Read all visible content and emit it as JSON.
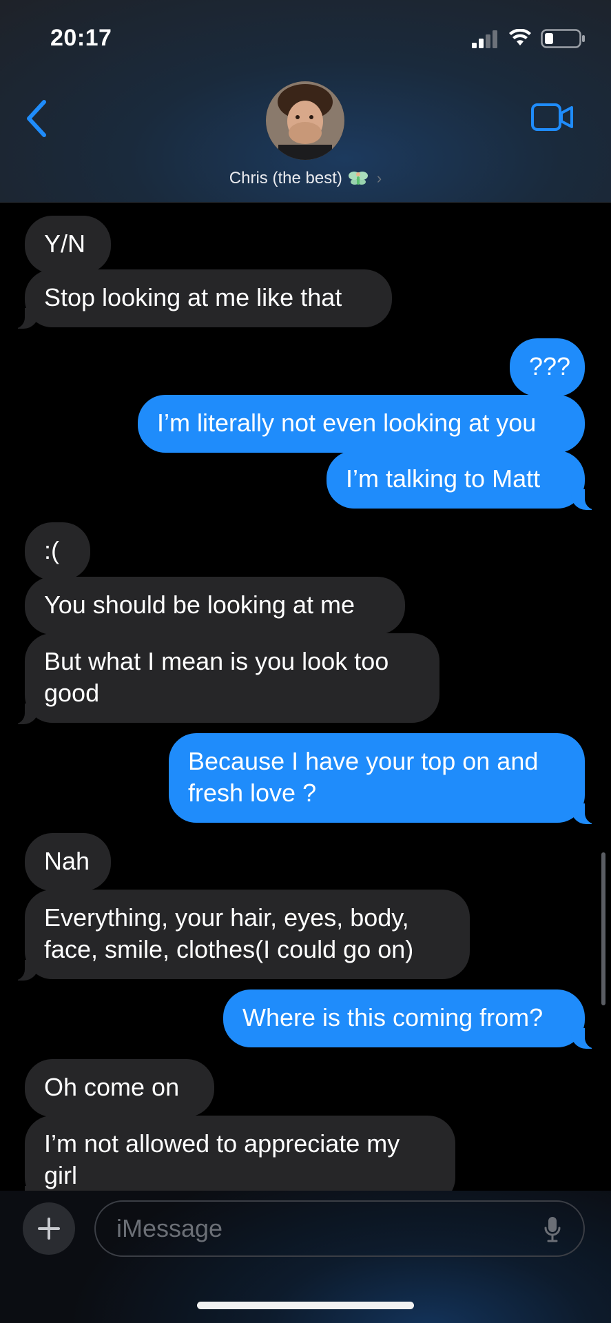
{
  "status_bar": {
    "time": "20:17"
  },
  "header": {
    "contact_name": "Chris (the best)",
    "contact_emoji": "fairy-icon",
    "back_icon": "chevron-left-icon",
    "video_icon": "video-camera-icon"
  },
  "colors": {
    "accent": "#1f8cfb",
    "received_bubble": "#262628",
    "background": "#000000"
  },
  "messages": [
    {
      "side": "received",
      "text": "Y/N"
    },
    {
      "side": "received",
      "text": "Stop looking at me like that"
    },
    {
      "side": "sent",
      "text": "???"
    },
    {
      "side": "sent",
      "text": "I’m literally not even looking at you"
    },
    {
      "side": "sent",
      "text": "I’m talking to Matt"
    },
    {
      "side": "received",
      "text": ":("
    },
    {
      "side": "received",
      "text": "You should be looking at me"
    },
    {
      "side": "received",
      "text": "But what I mean is you look too good"
    },
    {
      "side": "sent",
      "text": "Because I have your top on and fresh love ?"
    },
    {
      "side": "received",
      "text": "Nah"
    },
    {
      "side": "received",
      "text": "Everything, your hair, eyes, body, face, smile, clothes(I could go on)"
    },
    {
      "side": "sent",
      "text": "Where is this coming from?"
    },
    {
      "side": "received",
      "text": "Oh come on"
    },
    {
      "side": "received",
      "text": "I’m not allowed to appreciate my girl"
    }
  ],
  "composer": {
    "placeholder": "iMessage",
    "plus_icon": "plus-icon",
    "mic_icon": "microphone-icon"
  }
}
